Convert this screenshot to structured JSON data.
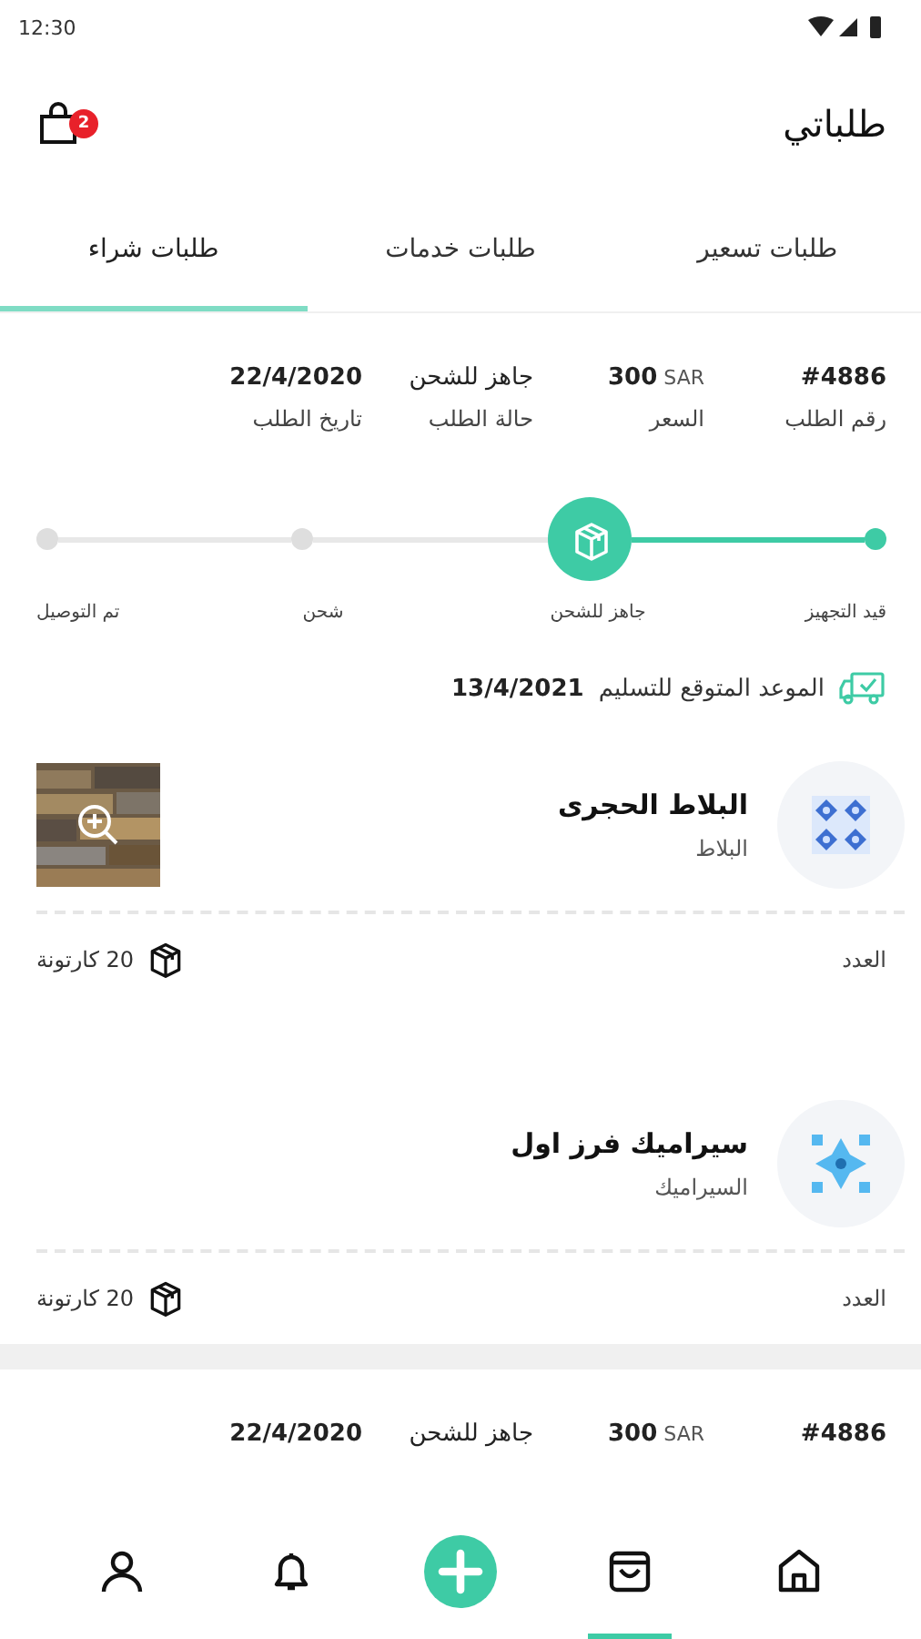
{
  "status_bar": {
    "time": "12:30"
  },
  "header": {
    "title": "طلباتي",
    "cart_badge": "2"
  },
  "tabs": [
    {
      "label": "طلبات تسعير",
      "selected": false
    },
    {
      "label": "طلبات خدمات",
      "selected": false
    },
    {
      "label": "طلبات  شراء",
      "selected": true
    }
  ],
  "orders": [
    {
      "fields": [
        {
          "value": "#4886",
          "label": "رقم الطلب"
        },
        {
          "value": "300",
          "currency": "SAR",
          "label": "السعر"
        },
        {
          "value": "جاهز للشحن",
          "label": "حالة الطلب"
        },
        {
          "value": "22/4/2020",
          "label": "تاريخ الطلب"
        }
      ],
      "progress": [
        {
          "label": "قيد التجهيز",
          "completed": true,
          "current": false
        },
        {
          "label": "جاهز للشحن",
          "completed": true,
          "current": true
        },
        {
          "label": "شحن",
          "completed": false,
          "current": false
        },
        {
          "label": "تم التوصيل",
          "completed": false,
          "current": false
        }
      ],
      "delivery": {
        "label": "الموعد المتوقع للتسليم",
        "date": "13/4/2021"
      },
      "items": [
        {
          "name": "البلاط الحجرى",
          "category": "البلاط",
          "quantity_label": "العدد",
          "quantity": "20 كارتونة",
          "has_photo": true
        },
        {
          "name": "سيراميك فرز اول",
          "category": "السيراميك",
          "quantity_label": "العدد",
          "quantity": "20 كارتونة",
          "has_photo": false
        }
      ]
    },
    {
      "fields": [
        {
          "value": "#4886"
        },
        {
          "value": "300",
          "currency": "SAR"
        },
        {
          "value": "جاهز للشحن"
        },
        {
          "value": "22/4/2020"
        }
      ]
    }
  ],
  "bottom_nav": [
    {
      "selected": false
    },
    {
      "selected": true
    },
    {
      "selected": false
    },
    {
      "selected": false
    },
    {
      "selected": false
    }
  ]
}
